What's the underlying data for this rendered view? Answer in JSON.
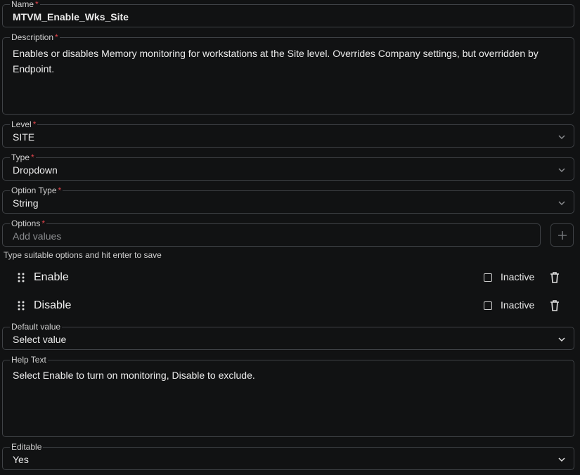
{
  "name": {
    "label": "Name",
    "value": "MTVM_Enable_Wks_Site"
  },
  "description": {
    "label": "Description",
    "value": "Enables or disables Memory monitoring for workstations at the Site level. Overrides Company settings, but overridden by Endpoint."
  },
  "level": {
    "label": "Level",
    "value": "SITE"
  },
  "type": {
    "label": "Type",
    "value": "Dropdown"
  },
  "option_type": {
    "label": "Option Type",
    "value": "String"
  },
  "options": {
    "label": "Options",
    "placeholder": "Add values",
    "hint": "Type suitable options and hit enter to save",
    "items": [
      {
        "label": "Enable",
        "inactive_label": "Inactive"
      },
      {
        "label": "Disable",
        "inactive_label": "Inactive"
      }
    ]
  },
  "default_value": {
    "label": "Default value",
    "value": "Select value"
  },
  "help_text": {
    "label": "Help Text",
    "value": "Select Enable to turn on monitoring, Disable to exclude."
  },
  "editable": {
    "label": "Editable",
    "value": "Yes"
  },
  "required_mark": "*",
  "icons": {
    "chevron": "chevron-down-icon",
    "plus": "plus-icon",
    "drag": "drag-handle-icon",
    "trash": "trash-icon",
    "checkbox": "checkbox-icon"
  },
  "colors": {
    "background": "#111213",
    "border": "#3f4246",
    "required": "#e0444b"
  }
}
